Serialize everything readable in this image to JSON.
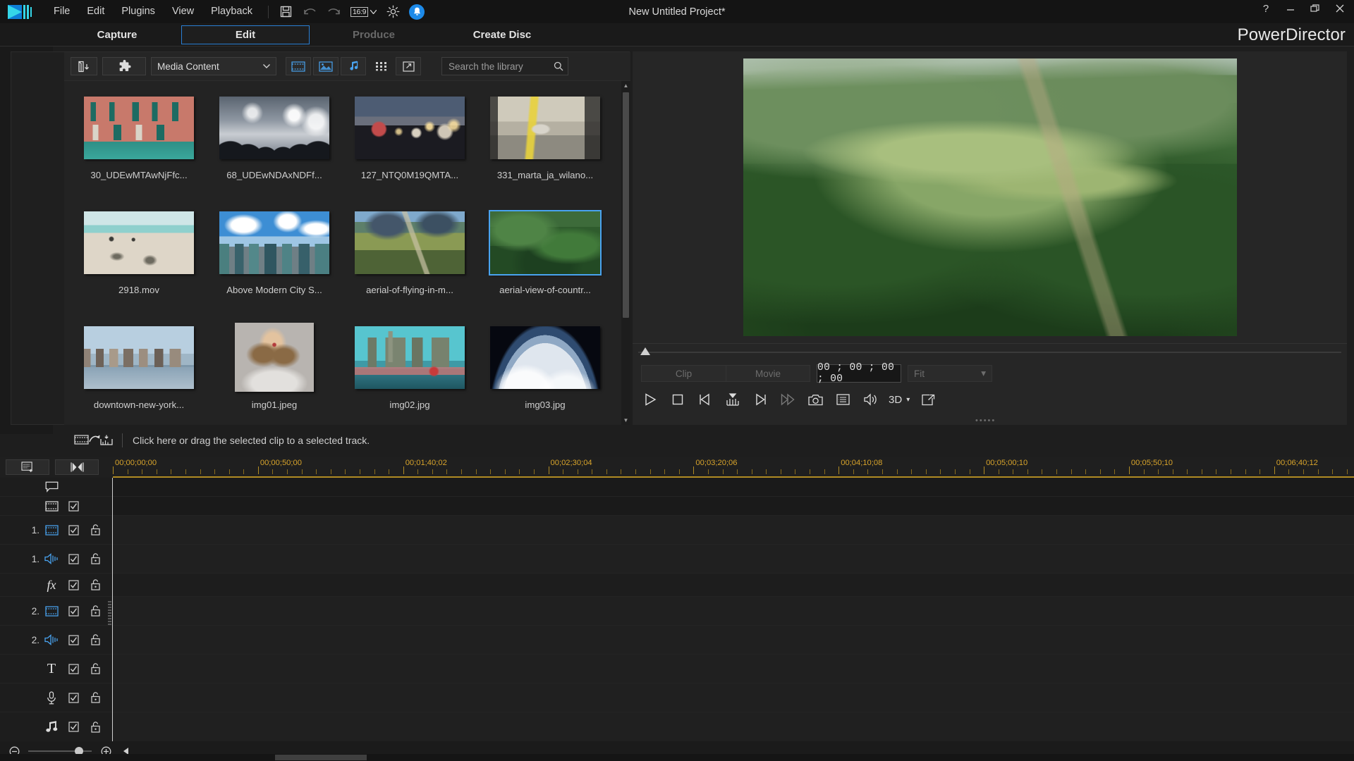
{
  "app": {
    "brand": "PowerDirector",
    "project_title": "New Untitled Project*"
  },
  "menubar": {
    "items": [
      "File",
      "Edit",
      "Plugins",
      "View",
      "Playback"
    ],
    "aspect_ratio": "16:9",
    "icons": [
      "save-icon",
      "undo-icon",
      "redo-icon",
      "aspect-ratio-selector",
      "preferences-gear-icon",
      "notification-bell-icon"
    ]
  },
  "window_controls": {
    "help": "?",
    "minimize": "—",
    "restore": "❐",
    "close": "✕"
  },
  "mode_tabs": [
    {
      "label": "Capture",
      "state": "normal"
    },
    {
      "label": "Edit",
      "state": "active"
    },
    {
      "label": "Produce",
      "state": "disabled"
    },
    {
      "label": "Create Disc",
      "state": "normal"
    }
  ],
  "room_rail": [
    {
      "name": "media-room",
      "icon": "clapperboard-icon",
      "selected": true
    },
    {
      "name": "effect-room",
      "icon": "fx-icon",
      "selected": false
    },
    {
      "name": "pip-objects-room",
      "icon": "pip-star-icon",
      "selected": false
    },
    {
      "name": "particle-room",
      "icon": "particle-icon",
      "selected": false
    },
    {
      "name": "title-room",
      "icon": "title-t-icon",
      "selected": false
    },
    {
      "name": "transition-room",
      "icon": "transition-icon",
      "selected": false
    },
    {
      "name": "audio-mixing-room",
      "icon": "audio-mixer-icon",
      "selected": false
    },
    {
      "name": "voice-over-room",
      "icon": "microphone-icon",
      "selected": false
    },
    {
      "name": "chapter-room",
      "icon": "chapter-icon",
      "selected": false
    },
    {
      "name": "subtitle-room",
      "icon": "subtitle-icon",
      "selected": false
    }
  ],
  "library": {
    "toolbar": {
      "import_label": "import-media-icon",
      "plugin_label": "plugins-icon",
      "filter_value": "Media Content",
      "filter_caret": "▾",
      "view_video_icon": "video-filter-icon",
      "view_image_icon": "image-filter-icon",
      "view_audio_icon": "audio-filter-icon",
      "grid_view_icon": "grid-view-icon",
      "expand_icon": "expand-library-icon"
    },
    "search": {
      "placeholder": "Search the library",
      "value": "",
      "icon": "search-icon"
    },
    "items": [
      {
        "label": "30_UDEwMTAwNjFfc...",
        "scene": "venice-house",
        "selected": false,
        "portrait": false
      },
      {
        "label": "68_UDEwNDAxNDFf...",
        "scene": "concert-crowd",
        "selected": false,
        "portrait": false
      },
      {
        "label": "127_NTQ0M19QMTA...",
        "scene": "sparklers-beach",
        "selected": false,
        "portrait": false
      },
      {
        "label": "331_marta_ja_wilano...",
        "scene": "garage-hall",
        "selected": false,
        "portrait": false
      },
      {
        "label": "2918.mov",
        "scene": "beach-walkers",
        "selected": false,
        "portrait": false
      },
      {
        "label": "Above Modern City S...",
        "scene": "modern-city",
        "selected": false,
        "portrait": false
      },
      {
        "label": "aerial-of-flying-in-m...",
        "scene": "aerial-mountain",
        "selected": false,
        "portrait": false
      },
      {
        "label": "aerial-view-of-countr...",
        "scene": "aerial-green-valley",
        "selected": true,
        "portrait": false
      },
      {
        "label": "downtown-new-york...",
        "scene": "nyc-skyline",
        "selected": false,
        "portrait": false
      },
      {
        "label": "img01.jpeg",
        "scene": "portrait-woman",
        "selected": false,
        "portrait": true
      },
      {
        "label": "img02.jpg",
        "scene": "london-bridge",
        "selected": false,
        "portrait": false
      },
      {
        "label": "img03.jpg",
        "scene": "earth-from-space",
        "selected": false,
        "portrait": false
      }
    ],
    "drop_hint": "Click here or drag the selected clip to a selected track.",
    "drop_hint_icon": "add-clip-to-track-icon"
  },
  "preview": {
    "scene": "aerial-green-valley",
    "mode_clip": "Clip",
    "mode_movie": "Movie",
    "timecode": "00 ; 00 ; 00 ; 00",
    "zoom_value": "Fit",
    "zoom_caret": "▾",
    "three_d_label": "3D",
    "three_d_caret": "▾",
    "controls": [
      {
        "name": "play-button",
        "icon": "play-icon"
      },
      {
        "name": "stop-button",
        "icon": "stop-icon"
      },
      {
        "name": "previous-frame-button",
        "icon": "prev-frame-icon"
      },
      {
        "name": "step-marker-button",
        "icon": "step-marker-icon"
      },
      {
        "name": "next-frame-button",
        "icon": "next-frame-icon"
      },
      {
        "name": "fast-forward-button",
        "icon": "fast-forward-icon"
      },
      {
        "name": "snapshot-button",
        "icon": "camera-icon"
      },
      {
        "name": "preview-quality-button",
        "icon": "list-icon"
      },
      {
        "name": "volume-button",
        "icon": "speaker-icon"
      },
      {
        "name": "three-d-button",
        "icon": "3d-icon"
      },
      {
        "name": "popup-preview-button",
        "icon": "pop-out-icon"
      }
    ]
  },
  "timeline": {
    "toolbar": [
      {
        "name": "track-manager-button",
        "icon": "track-manager-icon"
      },
      {
        "name": "magnet-snap-button",
        "icon": "snap-icon"
      }
    ],
    "ruler_labels": [
      "00;00;00;00",
      "00;00;50;00",
      "00;01;40;02",
      "00;02;30;04",
      "00;03;20;06",
      "00;04;10;08",
      "00;05;00;10",
      "00;05;50;10",
      "00;06;40;12"
    ],
    "tracks": [
      {
        "name": "marker-track",
        "num": "",
        "icon": "marker-balloon-icon",
        "checkbox": false,
        "lock": false
      },
      {
        "name": "master-video-track",
        "num": "",
        "icon": "master-video-icon",
        "checkbox": true,
        "lock": false
      },
      {
        "name": "video-track-1",
        "num": "1.",
        "icon": "video-track-icon",
        "checkbox": true,
        "lock": true
      },
      {
        "name": "audio-track-1",
        "num": "1.",
        "icon": "audio-track-icon",
        "checkbox": true,
        "lock": true
      },
      {
        "name": "effect-track",
        "num": "",
        "icon": "fx-icon",
        "checkbox": true,
        "lock": true
      },
      {
        "name": "video-track-2",
        "num": "2.",
        "icon": "video-track-icon",
        "checkbox": true,
        "lock": true
      },
      {
        "name": "audio-track-2",
        "num": "2.",
        "icon": "audio-track-icon",
        "checkbox": true,
        "lock": true
      },
      {
        "name": "title-track",
        "num": "",
        "icon": "title-t-icon",
        "checkbox": true,
        "lock": true
      },
      {
        "name": "voice-track",
        "num": "",
        "icon": "microphone-icon",
        "checkbox": true,
        "lock": true
      },
      {
        "name": "music-track",
        "num": "",
        "icon": "music-note-icon",
        "checkbox": true,
        "lock": true
      }
    ],
    "zoom": {
      "out_icon": "zoom-out-icon",
      "in_icon": "zoom-in-icon",
      "scroll_left_icon": "scroll-left-icon",
      "position_pct": 72
    }
  },
  "colors": {
    "accent_blue": "#2a8ae0",
    "ruler_amber": "#d8a42b",
    "panel_bg": "#1f1f1f",
    "window_bg": "#1e1e1e"
  }
}
